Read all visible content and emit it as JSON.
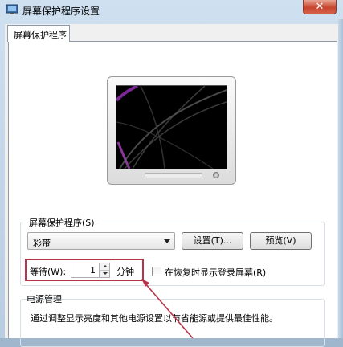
{
  "window": {
    "title": "屏幕保护程序设置",
    "close_label": "✕",
    "icon": "monitor-app-icon"
  },
  "tabs": [
    {
      "label": "屏幕保护程序",
      "selected": true
    }
  ],
  "screensaver": {
    "group_label": "屏幕保护程序(S)",
    "selected": "彩带",
    "settings_button": "设置(T)...",
    "preview_button": "预览(V)",
    "wait_label": "等待(W):",
    "wait_value": "1",
    "minutes_label": "分钟",
    "resume_checkbox_label": "在恢复时显示登录屏幕(R)",
    "resume_checked": false
  },
  "power": {
    "group_label": "电源管理",
    "description": "通过调整显示亮度和其他电源设置以节省能源或提供最佳性能。"
  },
  "colors": {
    "highlight_box": "#b8344a",
    "annotation_arrow": "#b8344a",
    "ribbon_purple": "#b040c8"
  }
}
